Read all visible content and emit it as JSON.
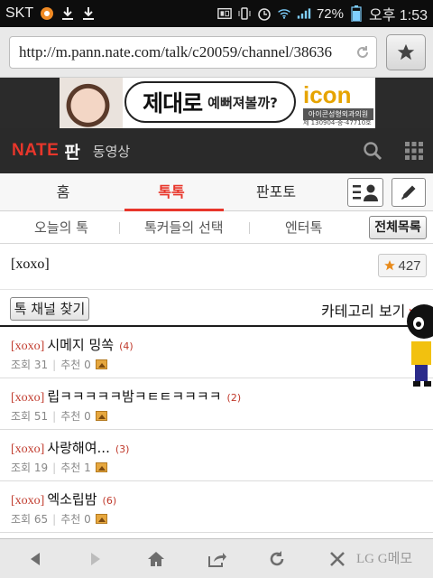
{
  "status_bar": {
    "carrier": "SKT",
    "battery": "72%",
    "clock": "오후 1:53"
  },
  "browser": {
    "url": "http://m.pann.nate.com/talk/c20059/channel/38636",
    "icons": [
      "reload-icon",
      "star-icon"
    ]
  },
  "ad": {
    "headline": "제대로",
    "sub": "예뻐져볼까?",
    "logo": "icon",
    "clinic": "아이콘성형외과의원",
    "reg": "제 130904-중-47710호"
  },
  "header": {
    "logo": "NATE",
    "service": "판",
    "link": "동영상"
  },
  "main_tabs": [
    {
      "label": "홈"
    },
    {
      "label": "톡톡",
      "active": true
    },
    {
      "label": "판포토"
    }
  ],
  "sub_tabs": [
    {
      "label": "오늘의 톡"
    },
    {
      "label": "톡커들의 선택"
    },
    {
      "label": "엔터톡"
    }
  ],
  "all_list_label": "전체목록",
  "channel": {
    "title": "[xoxo]",
    "favorite_count": "427"
  },
  "find_channel_label": "톡 채널 찾기",
  "category_label": "카테고리 보기",
  "posts": [
    {
      "tag": "[xoxo]",
      "title": "시메지 밍쏙",
      "comments": "(4)",
      "views_label": "조회 31",
      "likes_label": "추천 0"
    },
    {
      "tag": "[xoxo]",
      "title": "립ㅋㅋㅋㅋㅋ밤ㅋㅌㅌㅋㅋㅋㅋ",
      "comments": "(2)",
      "views_label": "조회 51",
      "likes_label": "추천 0"
    },
    {
      "tag": "[xoxo]",
      "title": "사랑해여...",
      "comments": "(3)",
      "views_label": "조회 19",
      "likes_label": "추천 1"
    },
    {
      "tag": "[xoxo]",
      "title": "엑소립밤",
      "comments": "(6)",
      "views_label": "조회 65",
      "likes_label": "추천 0"
    }
  ],
  "bottom_bar": {
    "watermark": "LG G메모",
    "icons": [
      "back-icon",
      "forward-icon",
      "home-icon",
      "share-icon",
      "refresh-icon",
      "close-icon"
    ]
  },
  "colors": {
    "accent": "#e8362b",
    "header_bg": "#2a2a2a",
    "status_bg": "#0d0d0d"
  }
}
